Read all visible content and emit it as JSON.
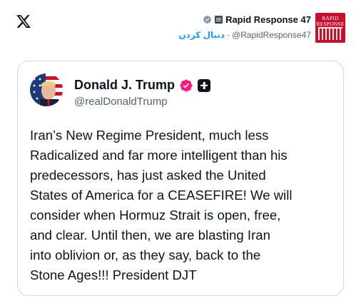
{
  "app": {
    "logo_icon": "x-logo"
  },
  "poster": {
    "name": "Rapid Response 47",
    "handle": "@RapidResponse47",
    "follow_label": "دنبال کردن",
    "separator": "·",
    "avatar_text": "RAPID RESPONSE",
    "badge_color": "#829aab"
  },
  "quoted_post": {
    "author_name": "Donald J. Trump",
    "author_handle": "@realDonaldTrump",
    "badge_color": "#f91880",
    "text": "Iran’s New Regime President, much less\nRadicalized and far more intelligent than his\npredecessors, has just asked the United\nStates of America for a CEASEFIRE! We will\nconsider when Hormuz Strait is open, free,\nand clear. Until then, we are blasting Iran\ninto oblivion or, as they say, back to the\nStone Ages!!! President DJT"
  }
}
